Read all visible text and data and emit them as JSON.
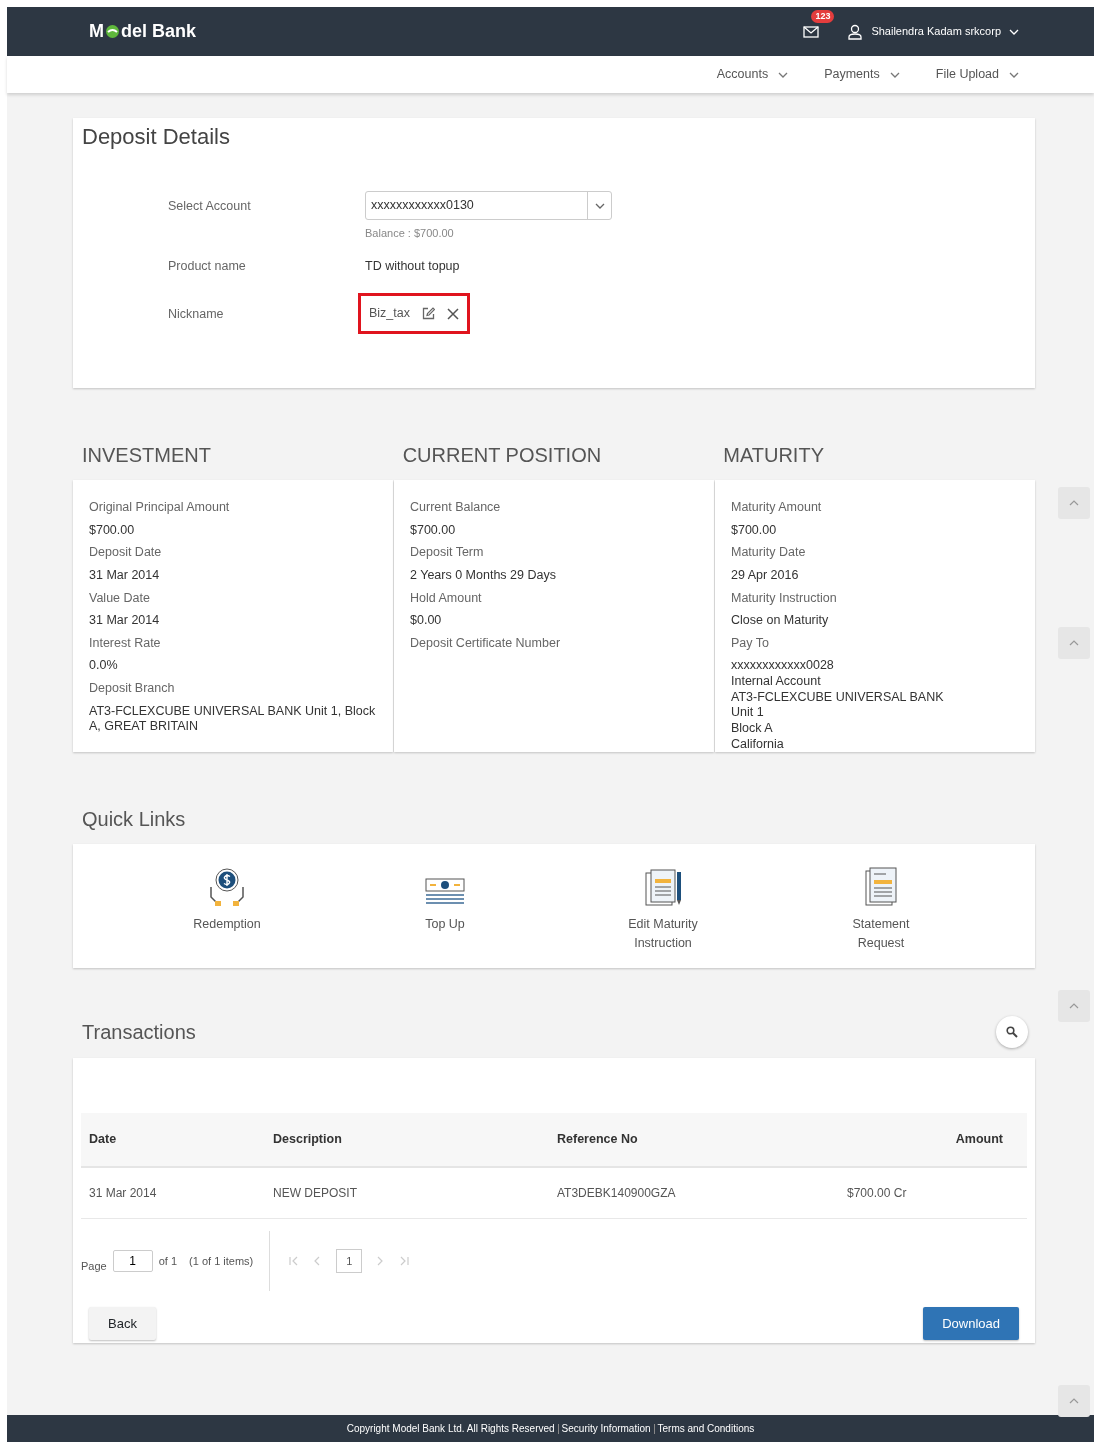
{
  "header": {
    "logo": {
      "before": "M",
      "after": "del Bank"
    },
    "notifications": "123",
    "user": "Shailendra Kadam srkcorp"
  },
  "menu": [
    {
      "label": "Accounts"
    },
    {
      "label": "Payments"
    },
    {
      "label": "File Upload"
    }
  ],
  "deposit_details": {
    "title": "Deposit Details",
    "select_account": {
      "label": "Select Account",
      "value": "xxxxxxxxxxxx0130",
      "balance": "Balance : $700.00"
    },
    "product": {
      "label": "Product name",
      "value": "TD without topup"
    },
    "nickname": {
      "label": "Nickname",
      "value": "Biz_tax",
      "highlighted": true
    }
  },
  "sections": [
    {
      "title": "INVESTMENT",
      "fields": [
        {
          "label": "Original Principal Amount",
          "value": "$700.00"
        },
        {
          "label": "Deposit Date",
          "value": "31 Mar 2014"
        },
        {
          "label": "Value Date",
          "value": "31 Mar 2014"
        },
        {
          "label": "Interest Rate",
          "value": "0.0%"
        },
        {
          "label": "Deposit Branch",
          "value": "AT3-FCLEXCUBE UNIVERSAL BANK Unit 1, Block A, GREAT BRITAIN"
        }
      ]
    },
    {
      "title": "CURRENT POSITION",
      "fields": [
        {
          "label": "Current Balance",
          "value": "$700.00"
        },
        {
          "label": "Deposit Term",
          "value": "2 Years 0 Months 29 Days"
        },
        {
          "label": "Hold Amount",
          "value": "$0.00"
        },
        {
          "label": "Deposit Certificate Number"
        }
      ]
    },
    {
      "title": "MATURITY",
      "fields": [
        {
          "label": "Maturity Amount",
          "value": "$700.00"
        },
        {
          "label": "Maturity Date",
          "value": "29 Apr 2016"
        },
        {
          "label": "Maturity Instruction",
          "value": "Close on Maturity"
        },
        {
          "label": "Pay To",
          "lines": [
            "xxxxxxxxxxxx0028",
            "Internal Account",
            "AT3-FCLEXCUBE UNIVERSAL BANK",
            "Unit 1",
            "Block A",
            "California"
          ]
        }
      ]
    }
  ],
  "quick_links": {
    "title": "Quick Links",
    "items": [
      {
        "kind": "redemption",
        "label": "Redemption"
      },
      {
        "kind": "topup",
        "label": "Top Up"
      },
      {
        "kind": "edit",
        "label": "Edit Maturity Instruction"
      },
      {
        "kind": "statement",
        "label": "Statement Request"
      }
    ]
  },
  "transactions": {
    "title": "Transactions",
    "table": {
      "columns": [
        "Date",
        "Description",
        "Reference No",
        "Amount"
      ],
      "rows": [
        [
          "31 Mar 2014",
          "NEW DEPOSIT",
          "AT3DEBK140900GZA",
          "$700.00 Cr"
        ]
      ]
    },
    "pagination": {
      "page_label": "Page",
      "page": "1",
      "of": "of 1",
      "items": "(1 of 1 items)",
      "current": "1",
      "nav": [
        {
          "kind": "first",
          "disabled": true
        },
        {
          "kind": "prev",
          "disabled": true
        },
        {
          "kind": "next",
          "disabled": true
        },
        {
          "kind": "last",
          "disabled": true
        }
      ]
    },
    "buttons": [
      {
        "kind": "secondary",
        "label": "Back"
      },
      {
        "kind": "primary",
        "label": "Download"
      }
    ]
  },
  "footer": [
    {
      "label": "Copyright Model Bank Ltd. All Rights Reserved"
    },
    {
      "label": "Security Information"
    },
    {
      "label": "Terms and Conditions"
    }
  ]
}
